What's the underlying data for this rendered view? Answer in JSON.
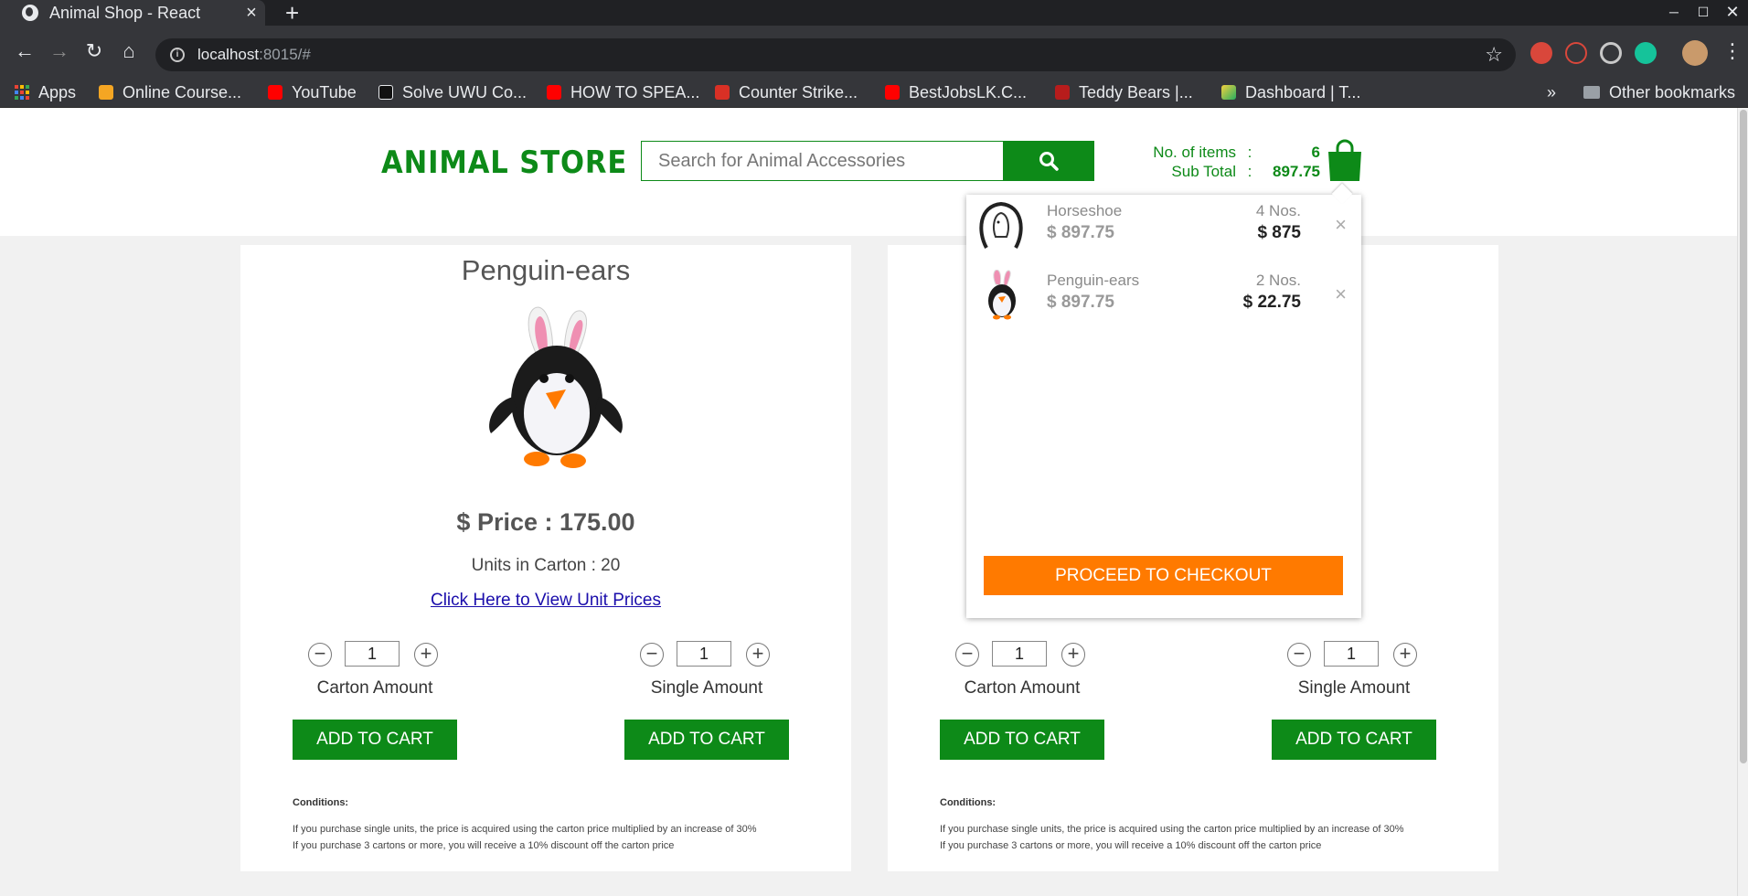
{
  "browser": {
    "tab_title": "Animal Shop - React",
    "tab_close": "×",
    "new_tab": "+",
    "url_host": "localhost",
    "url_rest": ":8015/#",
    "bookmarks": [
      {
        "label": "Apps"
      },
      {
        "label": "Online Course..."
      },
      {
        "label": "YouTube"
      },
      {
        "label": "Solve UWU Co..."
      },
      {
        "label": "HOW TO SPEA..."
      },
      {
        "label": "Counter Strike..."
      },
      {
        "label": "BestJobsLK.C..."
      },
      {
        "label": "Teddy Bears |..."
      },
      {
        "label": "Dashboard | T..."
      }
    ],
    "overflow": "»",
    "other_bookmarks": "Other bookmarks"
  },
  "header": {
    "logo": "ANIMAL STORE",
    "search_placeholder": "Search for Animal Accessories",
    "items_label": "No. of items",
    "items_sep": ":",
    "items_value": "6",
    "subtotal_label": "Sub Total",
    "subtotal_sep": ":",
    "subtotal_value": "897.75"
  },
  "cart_dropdown": {
    "items": [
      {
        "name": "Horseshoe",
        "price": "$ 897.75",
        "count": "4 Nos.",
        "total": "$ 875",
        "remove": "×"
      },
      {
        "name": "Penguin-ears",
        "price": "$ 897.75",
        "count": "2 Nos.",
        "total": "$ 22.75",
        "remove": "×"
      }
    ],
    "checkout_label": "PROCEED TO CHECKOUT"
  },
  "product": {
    "title": "Penguin-ears",
    "price": "$ Price : 175.00",
    "units": "Units in Carton : 20",
    "unit_link": "Click Here to View Unit Prices"
  },
  "controls": {
    "minus": "−",
    "plus": "+",
    "carton_qty": "1",
    "single_qty": "1",
    "carton_label": "Carton Amount",
    "single_label": "Single Amount",
    "add_label": "ADD TO CART"
  },
  "conditions": {
    "heading": "Conditions:",
    "line1": "If you purchase single units, the price is acquired using the carton price multiplied by an increase of 30%",
    "line2": "If you purchase 3 cartons or more, you will receive a 10% discount off the carton price"
  },
  "colors": {
    "brand_green": "#0d8a18",
    "checkout_orange": "#ff7a00"
  }
}
